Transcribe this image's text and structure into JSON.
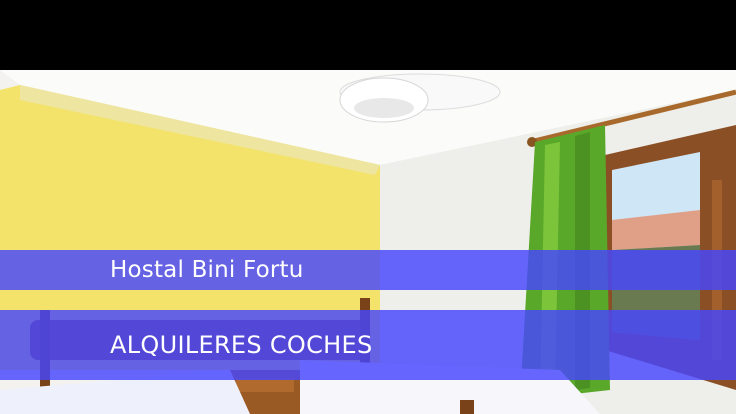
{
  "title": "Hostal Bini Fortu",
  "cta": "ALQUILERES COCHES",
  "colors": {
    "band": "#4646ff",
    "text": "#ffffff",
    "top_bar": "#000000"
  }
}
